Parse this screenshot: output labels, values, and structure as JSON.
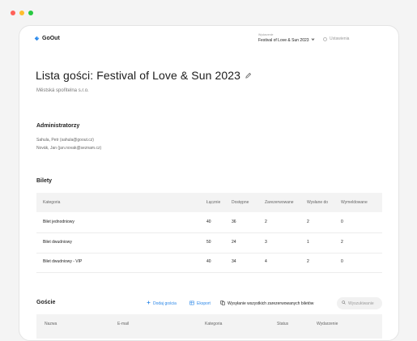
{
  "colors": {
    "dot_red": "#ff6159",
    "dot_yellow": "#ffbd2e",
    "dot_green": "#28c941",
    "accent": "#2b87e8",
    "logo_blue": "#2b87e8"
  },
  "header": {
    "logo_text": "GoOut",
    "event_caption": "Wydarzenie",
    "event_value": "Festival of Love & Sun 2023",
    "settings_label": "Ustawienia"
  },
  "page": {
    "title": "Lista gości: Festival of Love & Sun 2023",
    "company": "Městská spořitelna s.r.o."
  },
  "admins": {
    "title": "Administratorzy",
    "items": [
      "Sahula, Petr (sahula@goout.cz)",
      "Novák, Jan (jan.novak@seznam.cz)"
    ]
  },
  "tickets": {
    "title": "Bilety",
    "columns": [
      "Kategoria",
      "Łącznie",
      "Dostępne",
      "Zarezerwowane",
      "Wysłane do",
      "Wymeldowane"
    ],
    "rows": [
      [
        "Bilet jednodniowy",
        "40",
        "36",
        "2",
        "2",
        "0"
      ],
      [
        "Bilet dwudniowy",
        "50",
        "24",
        "3",
        "1",
        "2"
      ],
      [
        "Bilet dwudniowy - VIP",
        "40",
        "34",
        "4",
        "2",
        "0"
      ]
    ]
  },
  "guests": {
    "title": "Goście",
    "add_label": "Dodaj gościa",
    "export_label": "Eksport",
    "send_label": "Wysyłanie wszystkich zarezerwowanych biletów",
    "search_placeholder": "Wyszukiwanie",
    "columns": [
      "Nazwa",
      "E-mail",
      "Kategoria",
      "Status",
      "Wydarzenie"
    ]
  }
}
